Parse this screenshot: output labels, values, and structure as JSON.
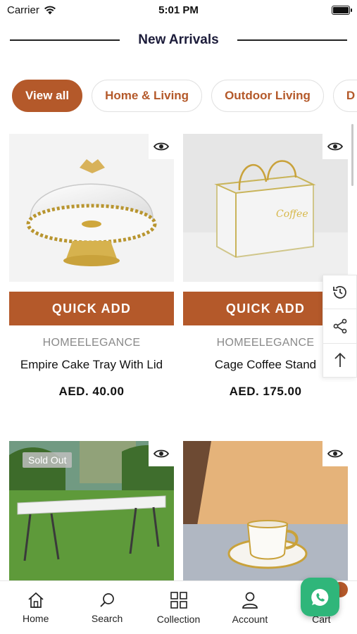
{
  "status_bar": {
    "carrier": "Carrier",
    "time": "5:01 PM"
  },
  "section": {
    "title": "New Arrivals"
  },
  "categories": [
    {
      "label": "View all",
      "active": true
    },
    {
      "label": "Home & Living",
      "active": false
    },
    {
      "label": "Outdoor Living",
      "active": false
    },
    {
      "label": "D",
      "active": false
    }
  ],
  "products": [
    {
      "quick_add": "QUICK ADD",
      "brand": "HOMEELEGANCE",
      "name": "Empire Cake Tray With Lid",
      "price": "AED. 40.00"
    },
    {
      "quick_add": "QUICK ADD",
      "brand": "HOMEELEGANCE",
      "name": "Cage Coffee Stand",
      "price": "AED. 175.00"
    },
    {
      "badge": "Sold Out"
    },
    {}
  ],
  "bottom_nav": [
    {
      "label": "Home",
      "icon": "home-icon"
    },
    {
      "label": "Search",
      "icon": "search-icon"
    },
    {
      "label": "Collection",
      "icon": "grid-icon"
    },
    {
      "label": "Account",
      "icon": "user-icon"
    },
    {
      "label": "Cart",
      "icon": "cart-icon"
    }
  ],
  "colors": {
    "accent": "#b4592a",
    "whatsapp": "#2fb67a",
    "title": "#1c1c3a"
  }
}
